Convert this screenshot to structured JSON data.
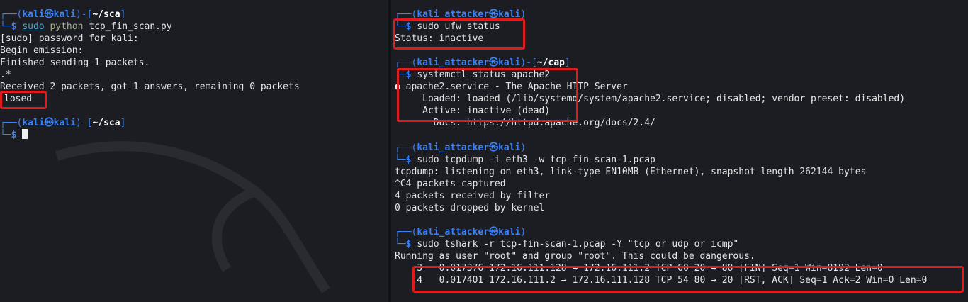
{
  "left": {
    "prompt1": {
      "user": "kali",
      "host": "kali",
      "path": "~/sca"
    },
    "command": {
      "sudo": "sudo",
      "prog": "python",
      "script": "tcp_fin_scan.py"
    },
    "output": [
      "[sudo] password for kali:",
      "Begin emission:",
      "Finished sending 1 packets.",
      ".*",
      "Received 2 packets, got 1 answers, remaining 0 packets",
      "losed"
    ],
    "prompt2": {
      "user": "kali",
      "host": "kali",
      "path": "~/sca"
    }
  },
  "right": {
    "b1": {
      "prompt": {
        "user": "kali_attacker",
        "host": "kali"
      },
      "command": "sudo ufw status",
      "output": [
        "Status: inactive"
      ]
    },
    "b2": {
      "prompt": {
        "user": "kali_attacker",
        "host": "kali",
        "path": "~/cap"
      },
      "command": "systemctl status apache2",
      "output": [
        "● apache2.service - The Apache HTTP Server",
        "     Loaded: loaded (/lib/systemd/system/apache2.service; disabled; vendor preset: disabled)",
        "     Active: inactive (dead)",
        "       Docs: https://httpd.apache.org/docs/2.4/"
      ]
    },
    "b3": {
      "prompt": {
        "user": "kali_attacker",
        "host": "kali"
      },
      "command": "sudo tcpdump -i eth3 -w tcp-fin-scan-1.pcap",
      "output": [
        "tcpdump: listening on eth3, link-type EN10MB (Ethernet), snapshot length 262144 bytes",
        "^C4 packets captured",
        "4 packets received by filter",
        "0 packets dropped by kernel"
      ]
    },
    "b4": {
      "prompt": {
        "user": "kali_attacker",
        "host": "kali"
      },
      "command": "sudo tshark -r tcp-fin-scan-1.pcap -Y \"tcp or udp or icmp\"",
      "output": [
        "Running as user \"root\" and group \"root\". This could be dangerous.",
        "    3   0.017376 172.16.111.128 → 172.16.111.2 TCP 60 20 → 80 [FIN] Seq=1 Win=8192 Len=0",
        "    4   0.017401 172.16.111.2 → 172.16.111.128 TCP 54 80 → 20 [RST, ACK] Seq=1 Ack=2 Win=0 Len=0"
      ]
    }
  },
  "colors": {
    "prompt": "#3b82f6",
    "highlight": "#e01b1b",
    "background": "#1b1d22"
  }
}
